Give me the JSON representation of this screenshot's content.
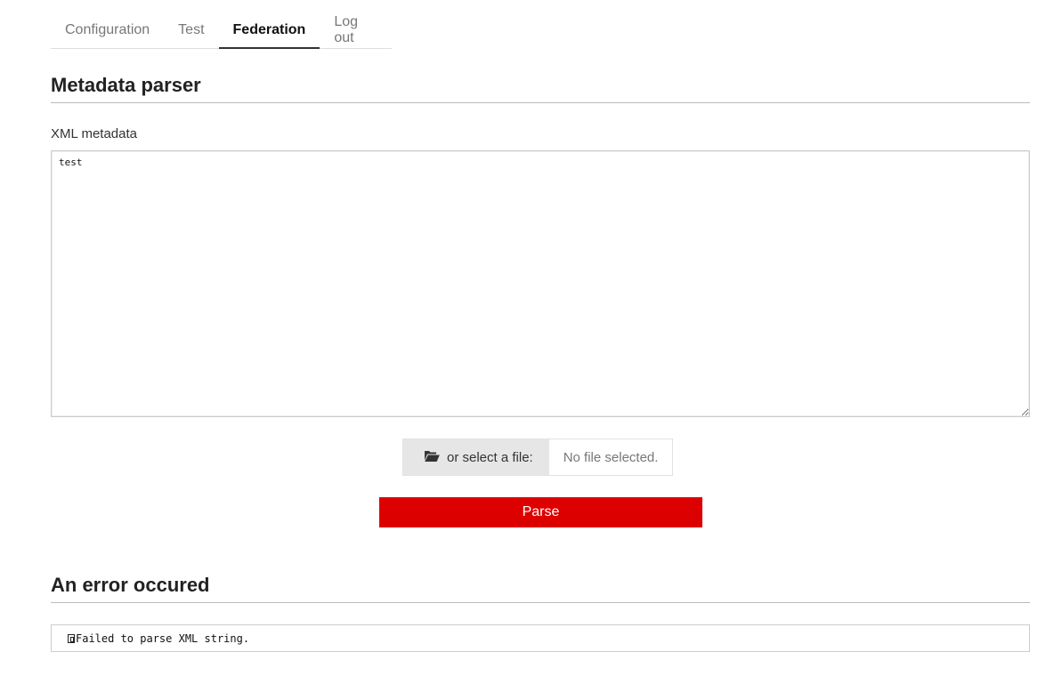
{
  "tabs": [
    {
      "label": "Configuration",
      "active": false
    },
    {
      "label": "Test",
      "active": false
    },
    {
      "label": "Federation",
      "active": true
    },
    {
      "label": "Log out",
      "active": false
    }
  ],
  "parser": {
    "title": "Metadata parser",
    "xml_label": "XML metadata",
    "xml_value": "test",
    "file_button_label": "or select a file:",
    "file_button_icon": "folder-open-icon",
    "file_status": "No file selected.",
    "parse_label": "Parse"
  },
  "error": {
    "title": "An error occured",
    "message": "Failed to parse XML string.",
    "icon": "unknown-glyph-icon"
  },
  "colors": {
    "parse_button": "#dd0000",
    "active_tab_underline": "#333333"
  }
}
